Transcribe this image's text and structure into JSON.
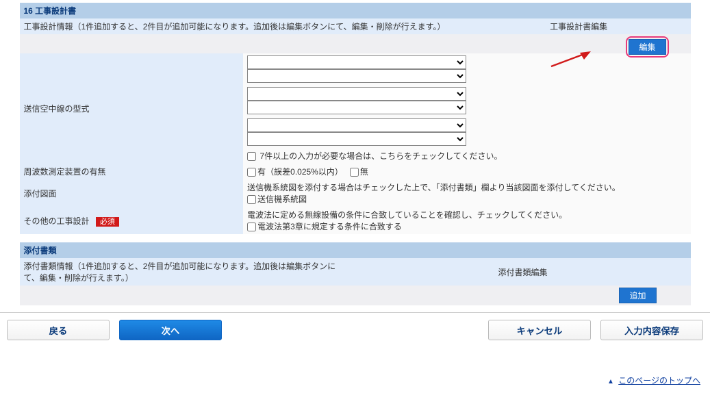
{
  "section1": {
    "title": "16 工事設計書",
    "info": "工事設計情報（1件追加すると、2件目が追加可能になります。追加後は編集ボタンにて、編集・削除が行えます。）",
    "editHeader": "工事設計書編集",
    "editBtn": "編集",
    "rows": {
      "txAntenna": {
        "label": "送信空中線の型式",
        "more7": "7件以上の入力が必要な場合は、こちらをチェックしてください。"
      },
      "freq": {
        "label": "周波数測定装置の有無",
        "opt1": "有（誤差0.025%以内）",
        "opt2": "無"
      },
      "attach": {
        "label": "添付図面",
        "note": "送信機系統図を添付する場合はチェックした上で、「添付書類」欄より当該図面を添付してください。",
        "cb": "送信機系統図"
      },
      "other": {
        "label": "その他の工事設計",
        "required": "必須",
        "note": "電波法に定める無線設備の条件に合致していることを確認し、チェックしてください。",
        "cb": "電波法第3章に規定する条件に合致する"
      }
    }
  },
  "section2": {
    "title": "添付書類",
    "info": "添付書類情報（1件追加すると、2件目が追加可能になります。追加後は編集ボタンにて、編集・削除が行えます。）",
    "editHeader": "添付書類編集",
    "addBtn": "追加"
  },
  "footer": {
    "back": "戻る",
    "next": "次へ",
    "cancel": "キャンセル",
    "save": "入力内容保存"
  },
  "pageTop": "このページのトップへ"
}
